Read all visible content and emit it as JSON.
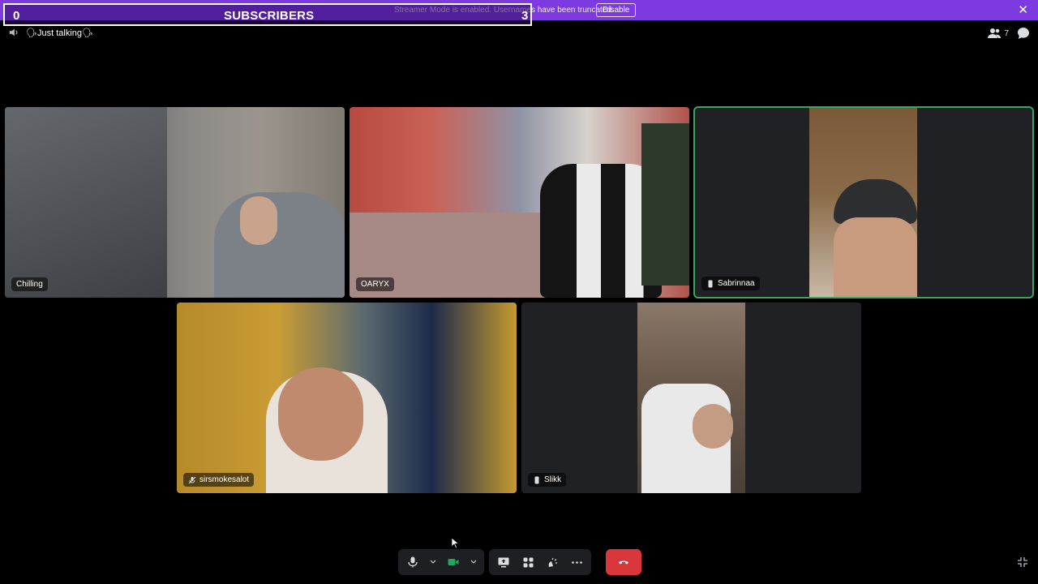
{
  "banner": {
    "message": "Streamer Mode is enabled. Usernames have been truncated.",
    "disable_label": "Disable",
    "bg": "#7d3ae0"
  },
  "subscribers": {
    "left_count": "0",
    "title": "SUBSCRIBERS",
    "right_count": "3"
  },
  "channel": {
    "name": "🗣Just talking🗣",
    "participants": "7"
  },
  "tiles": [
    {
      "name": "Chilling",
      "speaking": false,
      "icon": ""
    },
    {
      "name": "OARYX",
      "speaking": false,
      "icon": ""
    },
    {
      "name": "Sabrinnaa",
      "speaking": true,
      "icon": "mobile-icon"
    },
    {
      "name": "sirsmokesalot",
      "speaking": false,
      "icon": "muted-mic-icon"
    },
    {
      "name": "Slikk",
      "speaking": false,
      "icon": "mobile-icon"
    }
  ],
  "controls": {
    "icons": [
      "microphone-icon",
      "chevron-down-icon",
      "camera-icon",
      "chevron-down-icon",
      "screen-share-icon",
      "activities-icon",
      "soundboard-icon",
      "more-icon",
      "hang-up-icon"
    ],
    "end_color": "#da373c",
    "camera_on_color": "#23a55a"
  }
}
